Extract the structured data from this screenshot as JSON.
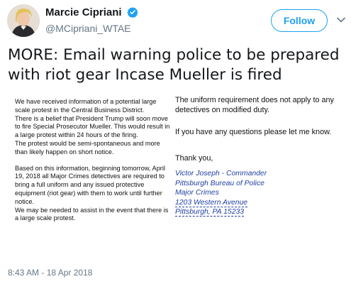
{
  "author": {
    "name": "Marcie Cipriani",
    "handle": "@MCipriani_WTAE",
    "verified_color": "#1da1f2"
  },
  "actions": {
    "follow_label": "Follow",
    "menu_icon": "chevron-down-icon"
  },
  "tweet": {
    "text": "MORE: Email warning police to be prepared with riot gear Incase Mueller is fired",
    "timestamp": "8:43 AM - 18 Apr 2018"
  },
  "email": {
    "left": {
      "p1": "We have received information of a potential large scale protest in the Central Business District.",
      "p2": "There is a belief that President Trump will soon move to fire Special Prosecutor Mueller. This would result in a large protest within 24 hours of the firing.",
      "p3": "The protest would be semi-spontaneous and more than likely happen on short notice.",
      "p4": "Based on this information, beginning tomorrow, April 19, 2018 all Major Crimes detectives are required to bring a full uniform and any issued protective equipment (riot gear) with them to work until further notice.",
      "p5": "We may be needed to assist in the event that there is a large scale protest."
    },
    "right": {
      "p1": "The uniform requirement does not apply to any detectives on modified duty.",
      "p2": "If you have any questions please let me know.",
      "thanks": "Thank you,",
      "sig_name": "Victor Joseph - Commander",
      "sig_org": "Pittsburgh Bureau of Police",
      "sig_unit": "Major Crimes",
      "sig_street": "1203 Western Avenue",
      "sig_city": "Pittsburgh, PA 15233"
    }
  },
  "colors": {
    "accent": "#1da1f2",
    "secondary_text": "#657786",
    "signature_blue": "#1f3fa3"
  }
}
